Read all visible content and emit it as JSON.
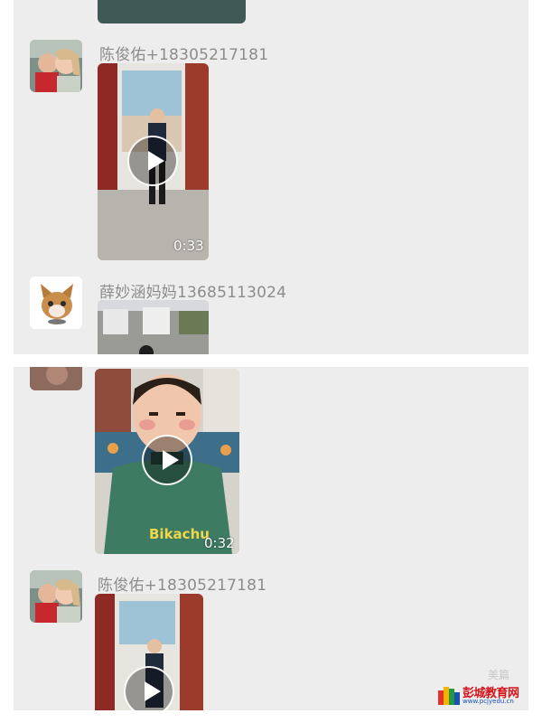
{
  "messages_top": [
    {
      "sender": "陈俊佑+18305217181",
      "avatar": "mother-child-avatar",
      "type": "video",
      "duration": "0:33"
    },
    {
      "sender": "薛妙涵妈妈13685113024",
      "avatar": "cat-avatar",
      "type": "video",
      "duration": ""
    }
  ],
  "messages_bottom": [
    {
      "sender": "",
      "avatar": "partial-avatar",
      "type": "video",
      "duration": "0:32"
    },
    {
      "sender": "陈俊佑+18305217181",
      "avatar": "mother-child-avatar",
      "type": "video",
      "duration": ""
    }
  ],
  "video_overlay_text": "Bikachu",
  "watermark": {
    "small_text": "美篇",
    "logo_title": "彭城教育网",
    "logo_url": "www.pcjyedu.cn"
  },
  "colors": {
    "background": "#ededed",
    "sender_text": "#8c8c8c",
    "logo_red": "#d4141a",
    "logo_blue": "#1a4fb5"
  }
}
